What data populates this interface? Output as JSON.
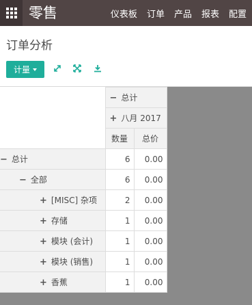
{
  "app": {
    "title": "零售"
  },
  "menu": [
    "仪表板",
    "订单",
    "产品",
    "报表",
    "配置"
  ],
  "breadcrumb": "订单分析",
  "toolbar": {
    "measures_label": "计量",
    "flip_icon": "arrows-icon",
    "expand_icon": "expand-icon",
    "download_icon": "download-icon"
  },
  "pivot": {
    "col_header_total": "总计",
    "col_header_period": "八月 2017",
    "measures": [
      "数量",
      "总价"
    ],
    "rows": [
      {
        "sym": "−",
        "label": "总计",
        "qty": "6",
        "price": "0.00",
        "bold": true
      },
      {
        "sym": "−",
        "label": "全部",
        "qty": "6",
        "price": "0.00",
        "bold": false
      },
      {
        "sym": "+",
        "label": "[MISC] 杂项",
        "qty": "2",
        "price": "0.00",
        "bold": false
      },
      {
        "sym": "+",
        "label": "存储",
        "qty": "1",
        "price": "0.00",
        "bold": false
      },
      {
        "sym": "+",
        "label": "模块 (会计)",
        "qty": "1",
        "price": "0.00",
        "bold": false
      },
      {
        "sym": "+",
        "label": "模块 (销售)",
        "qty": "1",
        "price": "0.00",
        "bold": false
      },
      {
        "sym": "+",
        "label": "香蕉",
        "qty": "1",
        "price": "0.00",
        "bold": false
      }
    ]
  }
}
